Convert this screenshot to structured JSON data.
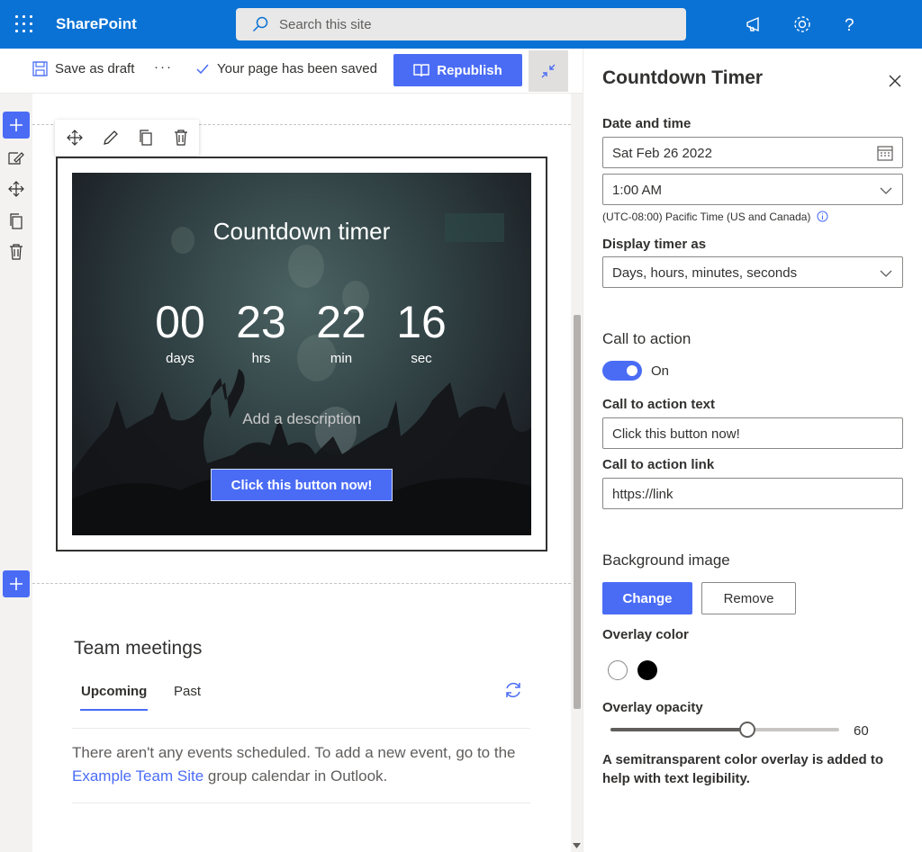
{
  "suite": {
    "brand": "SharePoint",
    "search_placeholder": "Search this site"
  },
  "cmdbar": {
    "save_draft": "Save as draft",
    "more": "···",
    "saved_status": "Your page has been saved",
    "republish": "Republish"
  },
  "timer": {
    "title": "Countdown timer",
    "units": [
      {
        "value": "00",
        "label": "days"
      },
      {
        "value": "23",
        "label": "hrs"
      },
      {
        "value": "22",
        "label": "min"
      },
      {
        "value": "16",
        "label": "sec"
      }
    ],
    "description_placeholder": "Add a description",
    "cta_label": "Click this button now!"
  },
  "team_meetings": {
    "title": "Team meetings",
    "tabs": [
      "Upcoming",
      "Past"
    ],
    "message_before": "There aren't any events scheduled. To add a new event, go to the ",
    "link_text": "Example Team Site",
    "message_after": " group calendar in Outlook."
  },
  "pane": {
    "title": "Countdown Timer",
    "date_time_label": "Date and time",
    "date_value": "Sat Feb 26 2022",
    "time_value": "1:00 AM",
    "timezone": "(UTC-08:00) Pacific Time (US and Canada)",
    "display_as_label": "Display timer as",
    "display_as_value": "Days, hours, minutes, seconds",
    "cta_heading": "Call to action",
    "toggle_label": "On",
    "cta_text_label": "Call to action text",
    "cta_text_value": "Click this button now!",
    "cta_link_label": "Call to action link",
    "cta_link_value": "https://link",
    "bg_heading": "Background image",
    "change_btn": "Change",
    "remove_btn": "Remove",
    "overlay_color_label": "Overlay color",
    "overlay_colors": [
      "#ffffff",
      "#000000"
    ],
    "overlay_opacity_label": "Overlay opacity",
    "overlay_opacity": 60,
    "overlay_note": "A semitransparent color overlay is added to help with text legibility."
  },
  "colors": {
    "suite_blue": "#0a72d4",
    "accent": "#4a6cf5"
  }
}
